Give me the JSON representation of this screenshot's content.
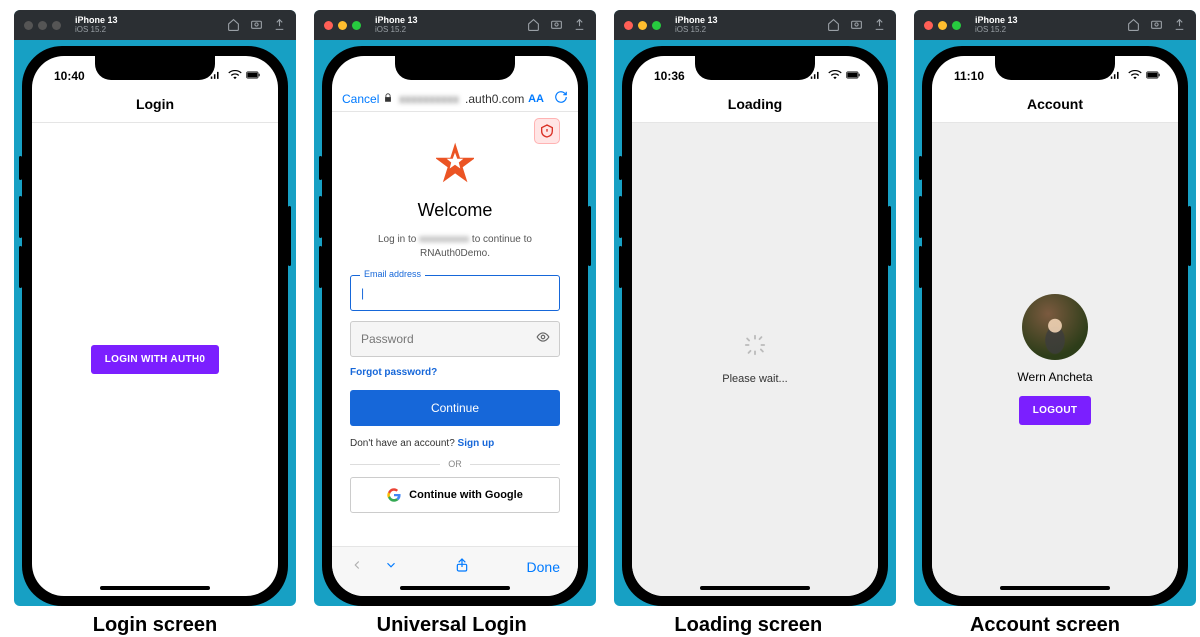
{
  "simulator": {
    "device": "iPhone 13",
    "os": "iOS 15.2"
  },
  "captions": {
    "login": "Login screen",
    "universal": "Universal Login",
    "loading": "Loading screen",
    "account": "Account screen"
  },
  "screen1": {
    "time": "10:40",
    "title": "Login",
    "button": "LOGIN WITH AUTH0"
  },
  "screen2": {
    "cancel": "Cancel",
    "domain_suffix": ".auth0.com",
    "aa": "AA",
    "welcome": "Welcome",
    "subtext_prefix": "Log in to ",
    "subtext_suffix": " to continue to RNAuth0Demo.",
    "email_label": "Email address",
    "password_placeholder": "Password",
    "forgot": "Forgot password?",
    "continue": "Continue",
    "signup_prompt": "Don't have an account?  ",
    "signup_link": "Sign up",
    "or": "OR",
    "google": "Continue with Google",
    "done": "Done"
  },
  "screen3": {
    "time": "10:36",
    "title": "Loading",
    "wait": "Please wait..."
  },
  "screen4": {
    "time": "11:10",
    "title": "Account",
    "user": "Wern Ancheta",
    "logout": "LOGOUT"
  }
}
